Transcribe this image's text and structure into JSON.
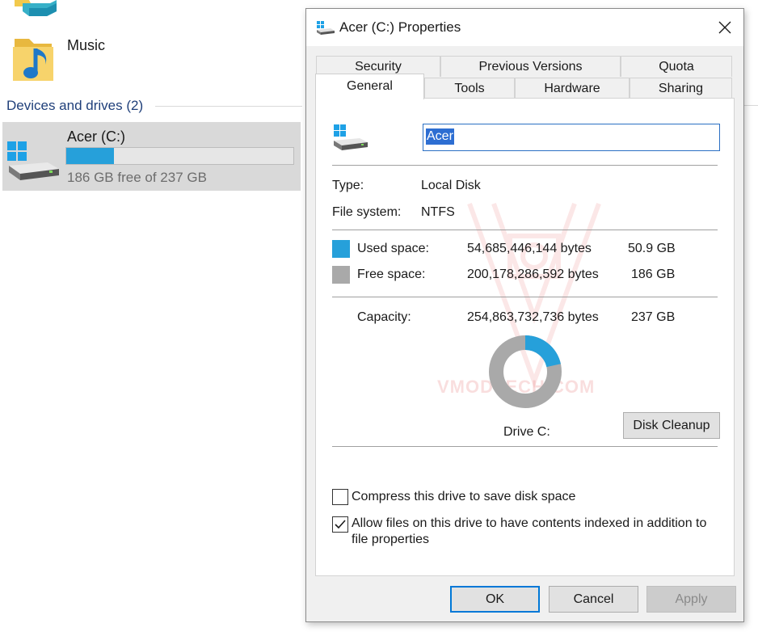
{
  "explorer": {
    "music_label": "Music",
    "group_header": "Devices and drives (2)",
    "drive": {
      "name": "Acer (C:)",
      "used_fraction": 0.21,
      "status": "186 GB free of 237 GB"
    }
  },
  "dialog": {
    "title": "Acer (C:) Properties",
    "tabs_back": [
      "Security",
      "Previous Versions",
      "Quota"
    ],
    "tabs_front": [
      "General",
      "Tools",
      "Hardware",
      "Sharing"
    ],
    "active_tab": "General",
    "general": {
      "name_value": "Acer",
      "type_label": "Type:",
      "type_value": "Local Disk",
      "fs_label": "File system:",
      "fs_value": "NTFS",
      "used_label": "Used space:",
      "used_bytes": "54,685,446,144 bytes",
      "used_gb": "50.9 GB",
      "free_label": "Free space:",
      "free_bytes": "200,178,286,592 bytes",
      "free_gb": "186 GB",
      "capacity_label": "Capacity:",
      "capacity_bytes": "254,863,732,736 bytes",
      "capacity_gb": "237 GB",
      "drive_label": "Drive C:",
      "cleanup_button": "Disk Cleanup",
      "used_fraction": 0.2146,
      "compress_label": "Compress this drive to save disk space",
      "compress_checked": false,
      "index_label_line1": "Allow files on this drive to have contents indexed in addition to",
      "index_label_line2": "file properties",
      "index_checked": true
    },
    "buttons": {
      "ok": "OK",
      "cancel": "Cancel",
      "apply": "Apply"
    },
    "colors": {
      "used": "#26a0da",
      "free": "#a9a9a9",
      "accent": "#0078d7"
    }
  },
  "watermark": "VMODTECH.COM"
}
